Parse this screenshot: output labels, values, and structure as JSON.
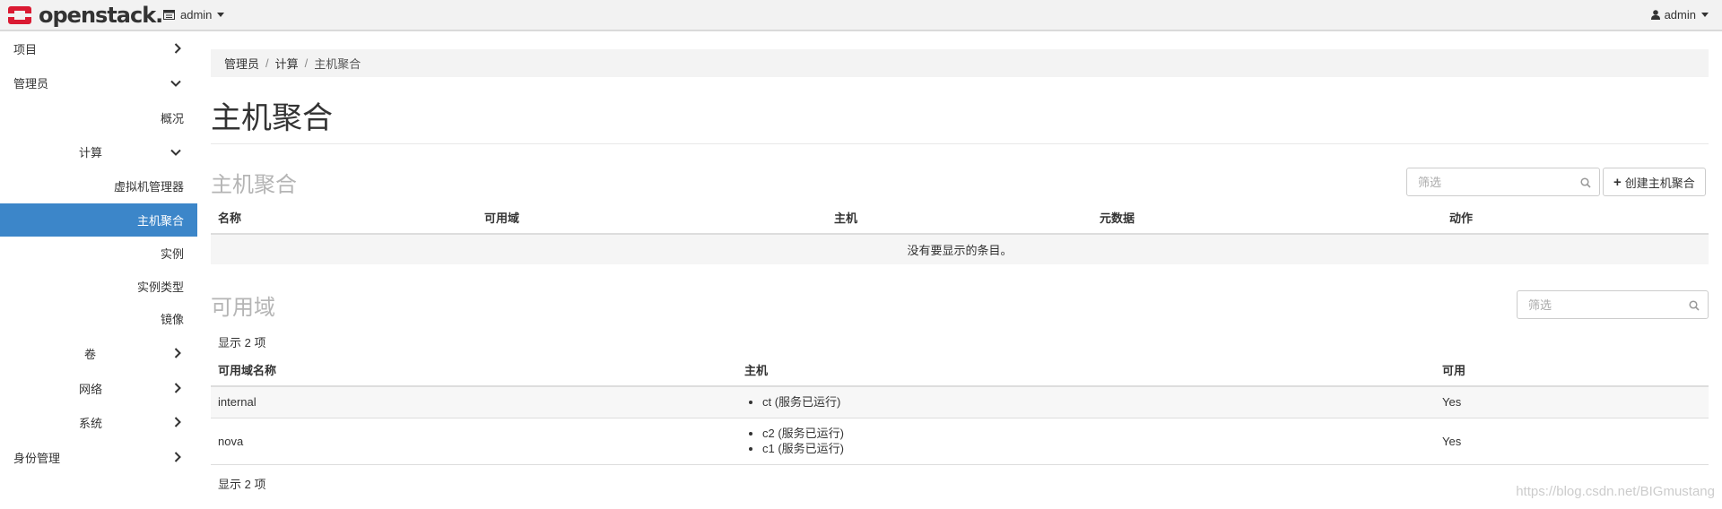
{
  "navbar": {
    "brand": "openstack.",
    "project": "admin",
    "user": "admin"
  },
  "sidebar": {
    "items": [
      {
        "label": "项目",
        "chevron": "right"
      },
      {
        "label": "管理员",
        "chevron": "down"
      },
      {
        "label": "概况"
      },
      {
        "label": "计算",
        "chevron": "down"
      },
      {
        "label": "虚拟机管理器"
      },
      {
        "label": "主机聚合",
        "active": true
      },
      {
        "label": "实例"
      },
      {
        "label": "实例类型"
      },
      {
        "label": "镜像"
      },
      {
        "label": "卷",
        "chevron": "right"
      },
      {
        "label": "网络",
        "chevron": "right"
      },
      {
        "label": "系统",
        "chevron": "right"
      },
      {
        "label": "身份管理",
        "chevron": "right"
      }
    ]
  },
  "breadcrumb": [
    "管理员",
    "计算",
    "主机聚合"
  ],
  "page_title": "主机聚合",
  "aggregates": {
    "title": "主机聚合",
    "filter_placeholder": "筛选",
    "create_label": "创建主机聚合",
    "columns": [
      "名称",
      "可用域",
      "主机",
      "元数据",
      "动作"
    ],
    "empty_text": "没有要显示的条目。"
  },
  "zones": {
    "title": "可用域",
    "filter_placeholder": "筛选",
    "count_top": "显示 2 项",
    "count_bottom": "显示 2 项",
    "columns": [
      "可用域名称",
      "主机",
      "可用"
    ],
    "rows": [
      {
        "name": "internal",
        "hosts": [
          "ct (服务已运行)"
        ],
        "available": "Yes"
      },
      {
        "name": "nova",
        "hosts": [
          "c2 (服务已运行)",
          "c1 (服务已运行)"
        ],
        "available": "Yes"
      }
    ]
  },
  "watermark": "https://blog.csdn.net/BIGmustang",
  "colors": {
    "active": "#3c86c9",
    "logo_red": "#da1a32"
  }
}
